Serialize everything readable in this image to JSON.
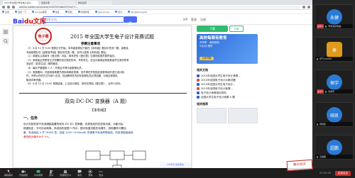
{
  "browser": {
    "tabs": [
      {
        "label": "2015年全国大学生电子设计..."
      },
      {
        "label": "百度文库"
      },
      {
        "label": "新标签页"
      }
    ],
    "url": "wenku.baidu.com/view/1005767a8d0751a77..."
  },
  "bookmarks": [
    "应用",
    "百度一下",
    "Google翻译",
    "淘宝",
    "知网",
    "哔哩哔哩",
    "OpenCores",
    "知乎",
    "NingNeChewell"
  ],
  "site": {
    "logo_main": "Bai",
    "logo_accent": "du文库",
    "search_placeholder": "搜索文档",
    "header_links": [
      "VIP",
      "登录",
      "注册"
    ]
  },
  "document": {
    "seal_text": "电子赛",
    "title": "2015 年全国大学生电子设计竞赛试题",
    "notes_heading": "参赛注意事项",
    "notes": [
      "（1）8 月 12 日 8:00 竞赛正式开始。本科组参赛队只能在【本科组】题目中任选一题；高职高",
      "     专组参赛队在【高职高专组】题目中任选一题，也可以选择【本科组】题目。",
      "（2）参赛队认真填写《登记表》内容，填写好的《登记表》交赛场巡视员暂时保存。",
      "（3）参赛者必须是有正式学籍的全日制在校本、专科学生，应出示能够证明参赛者学生身份的有",
      "     效证件（如学生证）随时备查。",
      "（4）每队严格限制 3 人，开赛后不得中途更换队员。",
      "（5）竞赛期间，可使用各种图书资料和网络资源，但不得在学校指定竞赛场地外进行设计制",
      "     作，不得以任何方式与他人交流，包括教师在内的非参赛队员必须回避，对违纪参赛队",
      "     取消评审资格。",
      "（6）8 月 15 日 20:00 竞赛结束，上交设计报告、制作实物及《登记表》，由专人封存。"
    ],
    "project_title": "双向 DC-DC 变换器（A 题）",
    "project_sub": "【本科组】",
    "task_heading": "一、任务",
    "task_lines": [
      "    设计并制作用于电池储能装置的双向 DC-DC 变换器，实现电池的充放电功能，功能可由",
      "按键设定，亦可自动转换。系统结构如图 1 所示，图中除直流稳压电源外，其他器件均需自",
      "备。电池组由 5 节 18650 型、容量 2000~3000mAh 的锂离子电池串联组成。所用电阻阻值误",
      "差的绝对值不大于 5%。"
    ],
    "figure_caption": "图 1 双向 DC-DC 变换器供电系统结构示意图",
    "vip_note": "VIP专享·免费阅读"
  },
  "right_panel": {
    "download_label": "下载",
    "share_label": "分享",
    "ad": {
      "line1": "高校每周有教育",
      "line2": "开学季 · 考研资料",
      "line3": "5元/月 限时",
      "cta": "立即领取"
    },
    "related_heading": "相关文档",
    "related": [
      {
        "title": "2015年全国大学生电子设计竞赛...",
        "kind": "doc"
      },
      {
        "title": "2015年全国电子设计大赛试题",
        "kind": "pdf"
      },
      {
        "title": "2015年全国大学生电子设计...",
        "kind": "doc"
      },
      {
        "title": "2013年全国电子设计竞赛...",
        "kind": "pdf"
      },
      {
        "title": "电子设计竞赛培训资料",
        "kind": "doc"
      },
      {
        "title": "全国大学生电子设计竞赛 A 题",
        "kind": "doc"
      }
    ],
    "recommend_heading": "相关推荐"
  },
  "participants": [
    {
      "initials": "永健",
      "label": "李永健的电脑",
      "role": "主持人",
      "color": "#2b7bd6"
    },
    {
      "initials": "捧",
      "label": "传气190450",
      "role": "",
      "color": "#e09a1c"
    },
    {
      "initials": "振宇",
      "label": "张振宇",
      "role": "主持人",
      "color": "#2b7bd6"
    },
    {
      "initials": "硕凯",
      "label": "周硕凯",
      "role": "",
      "color": "#2b7bd6"
    },
    {
      "initials": "超鹏",
      "label": "王超鹏",
      "role": "",
      "color": "#2b7bd6"
    }
  ],
  "toolbar": {
    "items": [
      {
        "label": "解除静音",
        "icon": "mic-off-icon"
      },
      {
        "label": "开启视频",
        "icon": "camera-icon"
      },
      {
        "label": "共享屏幕",
        "icon": "screen-share-icon"
      },
      {
        "label": "邀请",
        "icon": "invite-icon"
      },
      {
        "label": "管理成员(5)",
        "icon": "members-icon"
      },
      {
        "label": "聊天",
        "icon": "chat-icon"
      },
      {
        "label": "录制",
        "icon": "record-icon"
      },
      {
        "label": "更多",
        "icon": "more-icon"
      }
    ],
    "time": "01:53:26",
    "end_label": "结束会议"
  },
  "watermark_text": "腾讯会议"
}
